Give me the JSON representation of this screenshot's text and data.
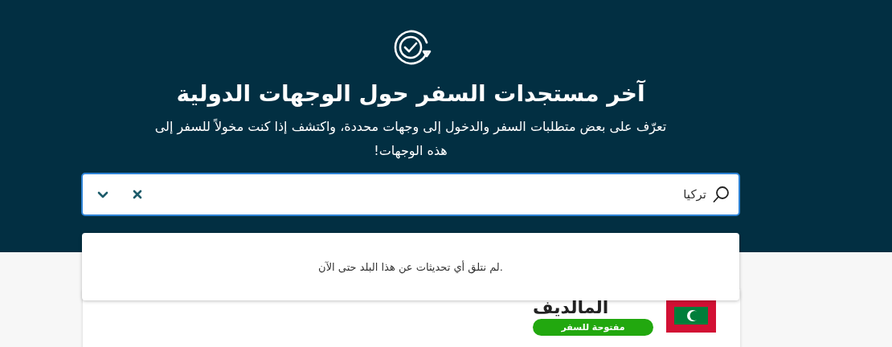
{
  "hero": {
    "title": "آخر مستجدات السفر حول الوجهات الدولية",
    "subtitle": "تعرّف على بعض متطلبات السفر والدخول إلى وجهات محددة، واكتشف إذا كنت مخولاً للسفر إلى هذه الوجهات!"
  },
  "search": {
    "value": "تركيا",
    "expanded": true
  },
  "dropdown": {
    "message": ".لم نتلق أي تحديثات عن هذا البلد حتى الآن"
  },
  "destinations": [
    {
      "name": "المالديف",
      "status": {
        "kind": "open",
        "label": "مفتوحة للسفر"
      }
    }
  ]
}
